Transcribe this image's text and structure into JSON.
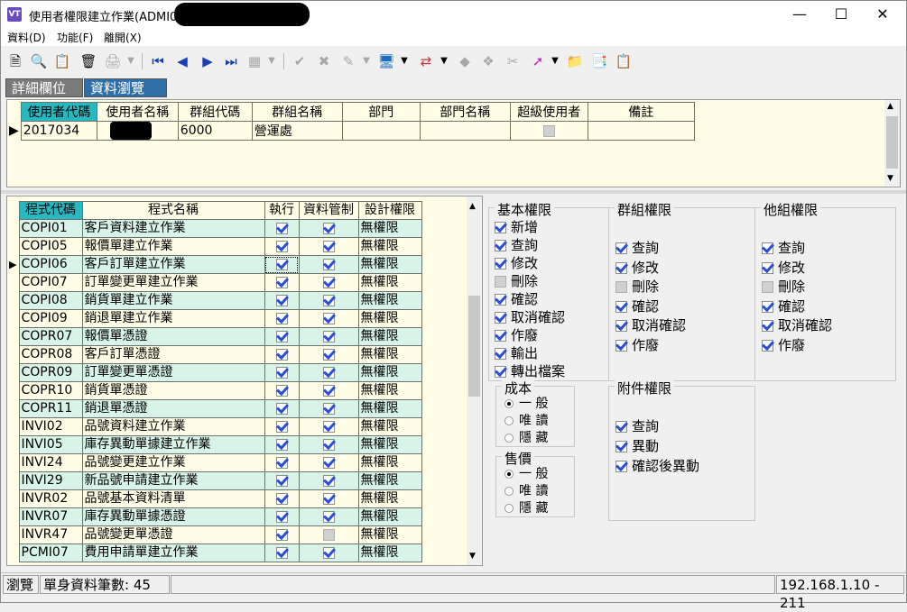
{
  "window": {
    "title": "使用者權限建立作業(ADMI05)",
    "app_icon": "VT"
  },
  "menu": [
    "資料(D)",
    "功能(F)",
    "離開(X)"
  ],
  "tabs": [
    {
      "label": "詳細欄位"
    },
    {
      "label": "資料瀏覽"
    }
  ],
  "user_grid": {
    "columns": [
      "使用者代碼",
      "使用者名稱",
      "群組代碼",
      "群組名稱",
      "部門",
      "部門名稱",
      "超級使用者",
      "備註"
    ],
    "row": {
      "user_code": "2017034",
      "group_code": "6000",
      "group_name": "營運處"
    }
  },
  "program_grid": {
    "columns": [
      "程式代碼",
      "程式名稱",
      "執行",
      "資料管制",
      "設計權限"
    ],
    "rows": [
      {
        "code": "COPI01",
        "name": "客戶資料建立作業",
        "exec": true,
        "ctrl": true,
        "design": "無權限"
      },
      {
        "code": "COPI05",
        "name": "報價單建立作業",
        "exec": true,
        "ctrl": true,
        "design": "無權限"
      },
      {
        "code": "COPI06",
        "name": "客戶訂單建立作業",
        "exec": true,
        "ctrl": true,
        "design": "無權限"
      },
      {
        "code": "COPI07",
        "name": "訂單變更單建立作業",
        "exec": true,
        "ctrl": true,
        "design": "無權限"
      },
      {
        "code": "COPI08",
        "name": "銷貨單建立作業",
        "exec": true,
        "ctrl": true,
        "design": "無權限"
      },
      {
        "code": "COPI09",
        "name": "銷退單建立作業",
        "exec": true,
        "ctrl": true,
        "design": "無權限"
      },
      {
        "code": "COPR07",
        "name": "報價單憑證",
        "exec": true,
        "ctrl": true,
        "design": "無權限"
      },
      {
        "code": "COPR08",
        "name": "客戶訂單憑證",
        "exec": true,
        "ctrl": true,
        "design": "無權限"
      },
      {
        "code": "COPR09",
        "name": "訂單變更單憑證",
        "exec": true,
        "ctrl": true,
        "design": "無權限"
      },
      {
        "code": "COPR10",
        "name": "銷貨單憑證",
        "exec": true,
        "ctrl": true,
        "design": "無權限"
      },
      {
        "code": "COPR11",
        "name": "銷退單憑證",
        "exec": true,
        "ctrl": true,
        "design": "無權限"
      },
      {
        "code": "INVI02",
        "name": "品號資料建立作業",
        "exec": true,
        "ctrl": true,
        "design": "無權限"
      },
      {
        "code": "INVI05",
        "name": "庫存異動單據建立作業",
        "exec": true,
        "ctrl": true,
        "design": "無權限"
      },
      {
        "code": "INVI24",
        "name": "品號變更建立作業",
        "exec": true,
        "ctrl": true,
        "design": "無權限"
      },
      {
        "code": "INVI29",
        "name": "新品號申請建立作業",
        "exec": true,
        "ctrl": true,
        "design": "無權限"
      },
      {
        "code": "INVR02",
        "name": "品號基本資料清單",
        "exec": true,
        "ctrl": true,
        "design": "無權限"
      },
      {
        "code": "INVR07",
        "name": "庫存異動單據憑證",
        "exec": true,
        "ctrl": true,
        "design": "無權限"
      },
      {
        "code": "INVR47",
        "name": "品號變更單憑證",
        "exec": true,
        "ctrl": false,
        "design": "無權限"
      },
      {
        "code": "PCMI07",
        "name": "費用申請單建立作業",
        "exec": true,
        "ctrl": true,
        "design": "無權限"
      }
    ]
  },
  "basic_perms": {
    "title": "基本權限",
    "items": [
      {
        "label": "新增",
        "on": true
      },
      {
        "label": "查詢",
        "on": true
      },
      {
        "label": "修改",
        "on": true
      },
      {
        "label": "刪除",
        "on": false
      },
      {
        "label": "確認",
        "on": true
      },
      {
        "label": "取消確認",
        "on": true
      },
      {
        "label": "作廢",
        "on": true
      },
      {
        "label": "輸出",
        "on": true
      },
      {
        "label": "轉出檔案",
        "on": true
      }
    ]
  },
  "group_perms": {
    "title": "群組權限",
    "items": [
      {
        "label": "查詢",
        "on": true
      },
      {
        "label": "修改",
        "on": true
      },
      {
        "label": "刪除",
        "on": false
      },
      {
        "label": "確認",
        "on": true
      },
      {
        "label": "取消確認",
        "on": true
      },
      {
        "label": "作廢",
        "on": true
      }
    ]
  },
  "other_perms": {
    "title": "他組權限",
    "items": [
      {
        "label": "查詢",
        "on": true
      },
      {
        "label": "修改",
        "on": true
      },
      {
        "label": "刪除",
        "on": false
      },
      {
        "label": "確認",
        "on": true
      },
      {
        "label": "取消確認",
        "on": true
      },
      {
        "label": "作廢",
        "on": true
      }
    ]
  },
  "attach_perms": {
    "title": "附件權限",
    "items": [
      {
        "label": "查詢",
        "on": true
      },
      {
        "label": "異動",
        "on": true
      },
      {
        "label": "確認後異動",
        "on": true
      }
    ]
  },
  "cost": {
    "title": "成本",
    "options": [
      "一 般",
      "唯 讀",
      "隱 藏"
    ],
    "selected": 0
  },
  "price": {
    "title": "售價",
    "options": [
      "一 般",
      "唯 讀",
      "隱 藏"
    ],
    "selected": 0
  },
  "status": {
    "mode": "瀏覽",
    "records": "單身資料筆數: 45",
    "server": "192.168.1.10 - 211"
  }
}
